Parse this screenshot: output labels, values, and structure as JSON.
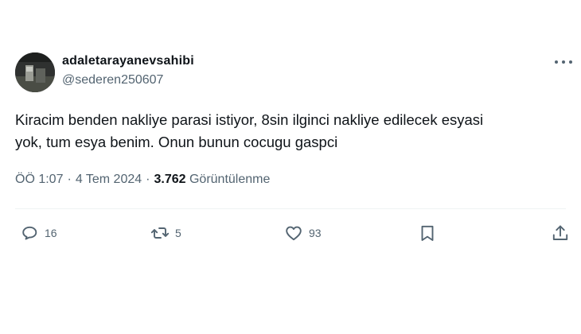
{
  "author": {
    "display_name": "adaletarayanevsahibi",
    "handle": "@sederen250607"
  },
  "tweet": {
    "text_line1": "Kiracim benden nakliye parasi istiyor, 8sin ilginci nakliye edilecek esyasi",
    "text_line2": "yok, tum esya benim. Onun bunun cocugu gaspci"
  },
  "meta": {
    "time": "ÖÖ 1:07",
    "separator": "·",
    "date": "4 Tem 2024",
    "views_count": "3.762",
    "views_label": "Görüntülenme"
  },
  "actions": {
    "reply_count": "16",
    "retweet_count": "5",
    "like_count": "93"
  },
  "icons": [
    "more-icon",
    "reply-icon",
    "retweet-icon",
    "like-icon",
    "bookmark-icon",
    "share-icon"
  ],
  "colors": {
    "text": "#0f1419",
    "secondary": "#536471",
    "divider": "#eff3f4"
  }
}
